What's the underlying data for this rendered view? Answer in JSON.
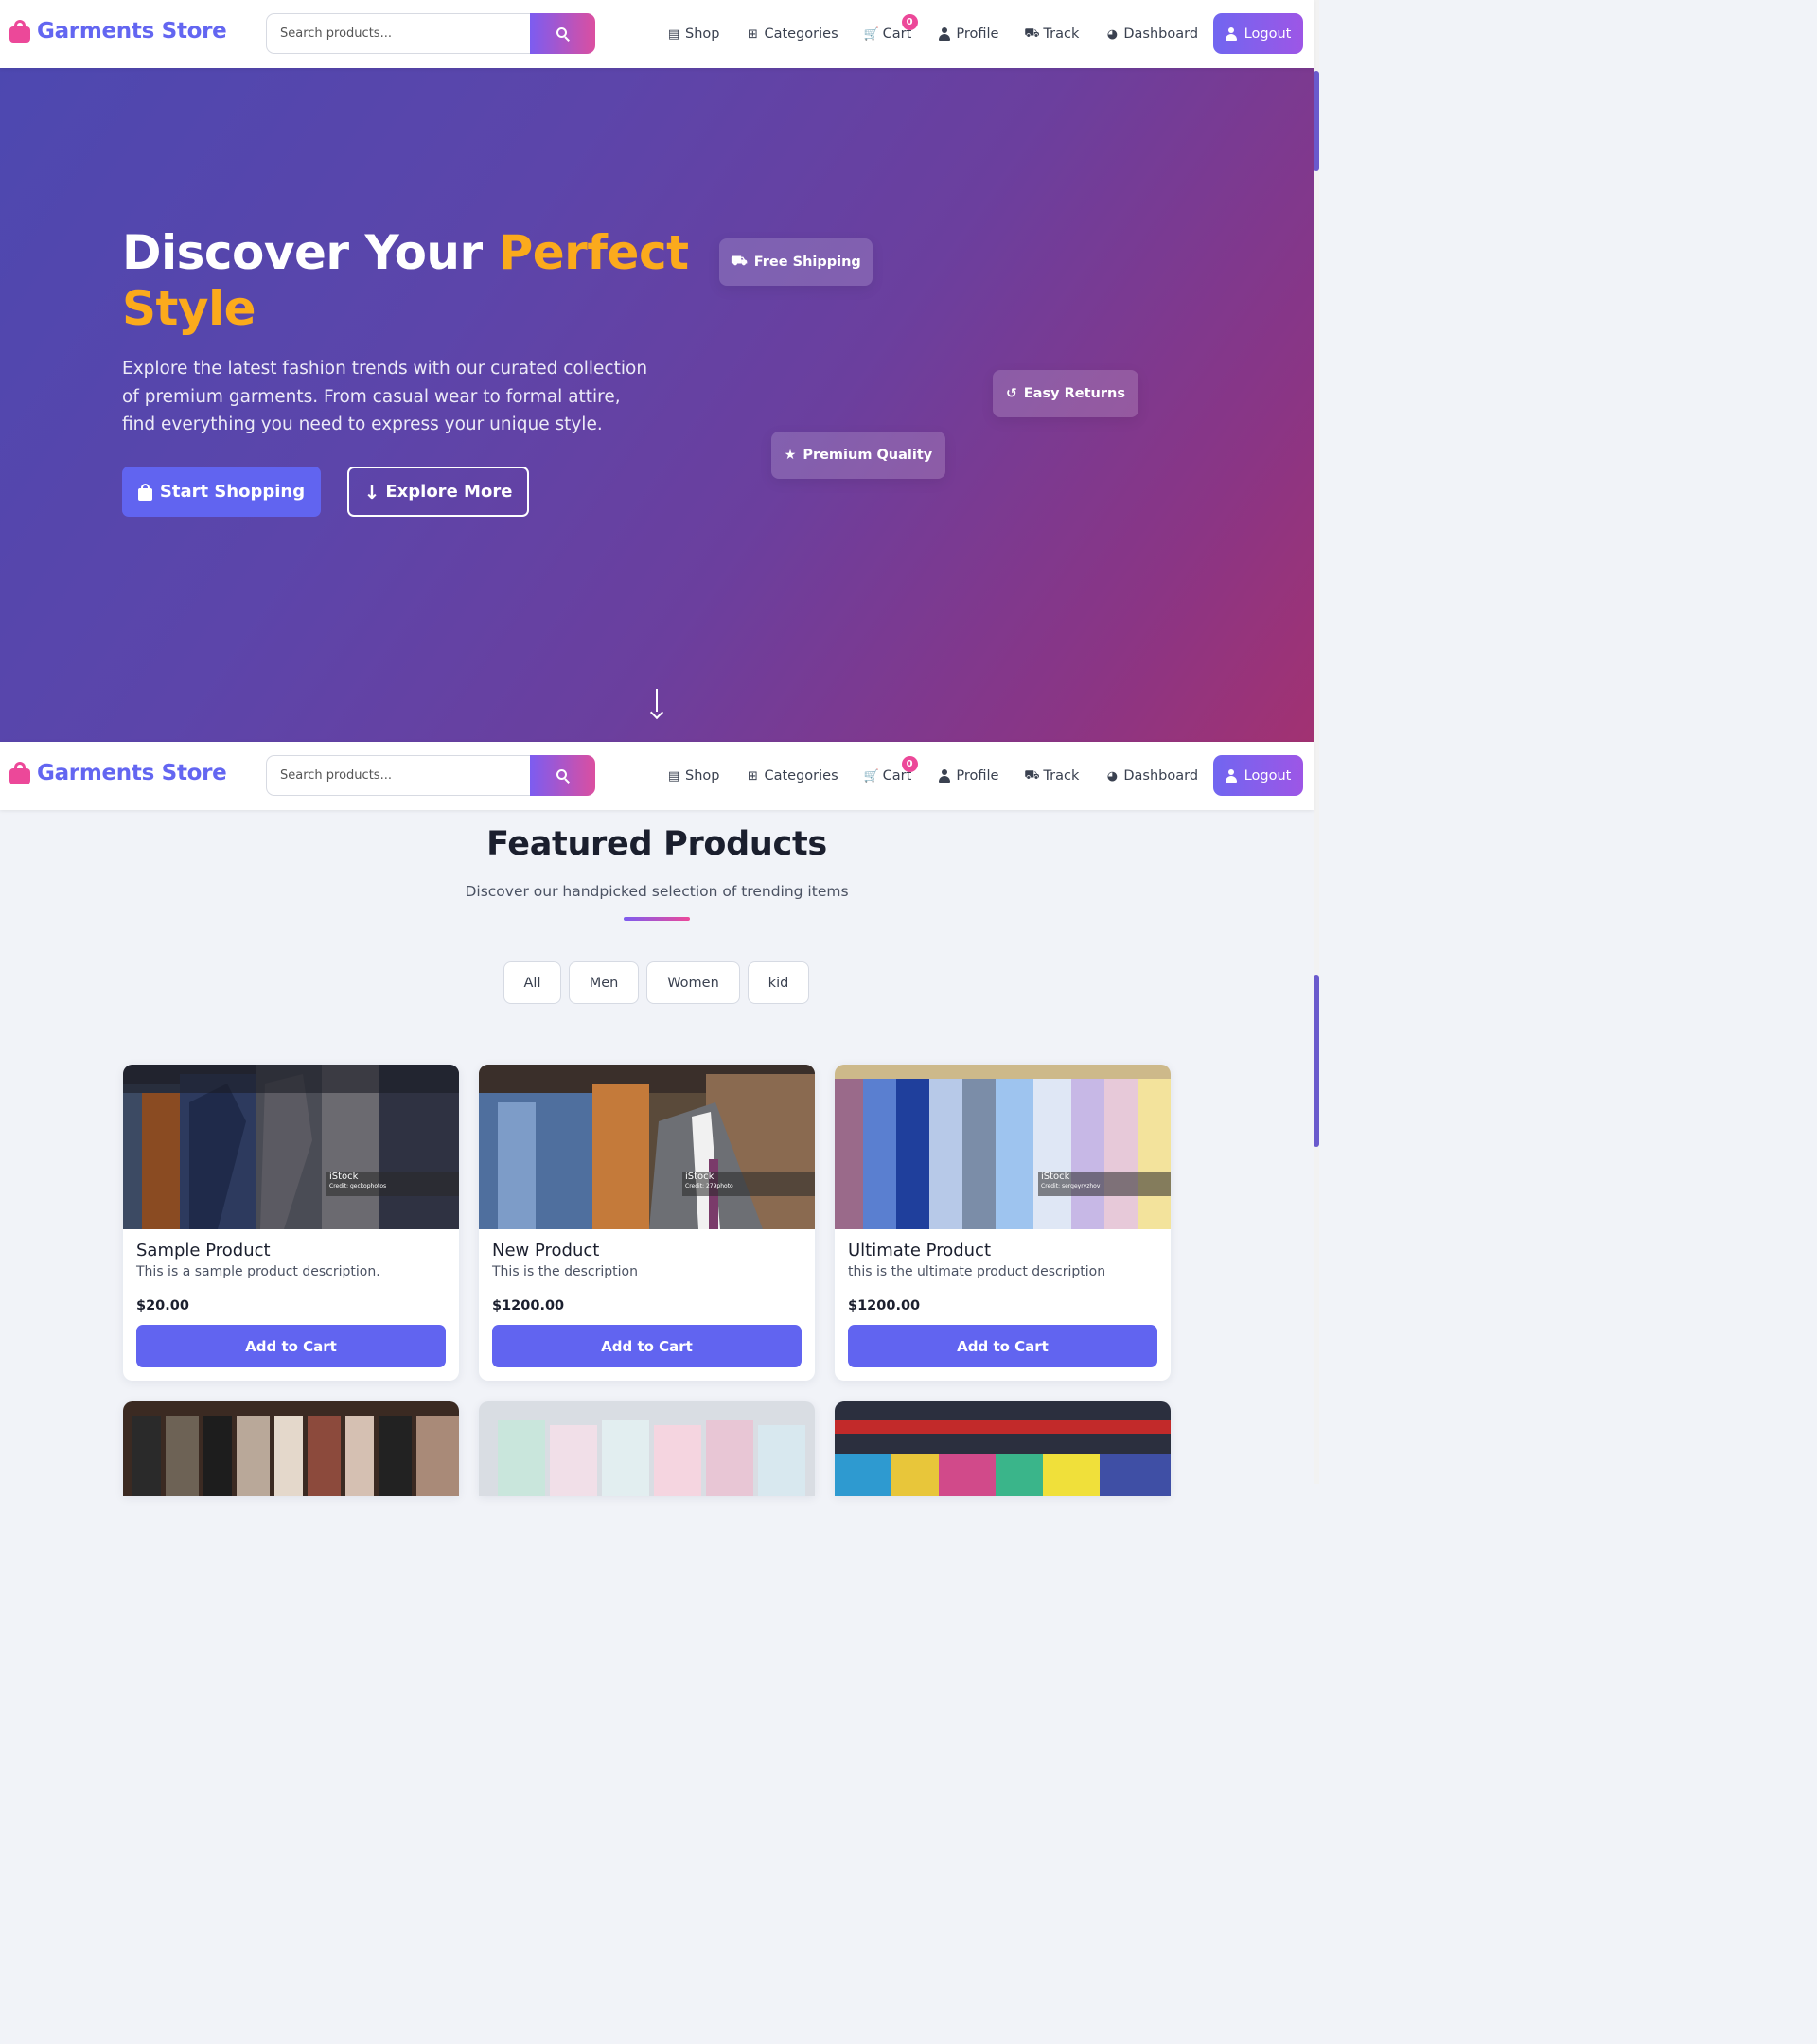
{
  "brand": {
    "name": "Garments Store"
  },
  "search": {
    "placeholder": "Search products..."
  },
  "nav": {
    "shop": "Shop",
    "categories": "Categories",
    "cart": "Cart",
    "cart_count": "0",
    "profile": "Profile",
    "track": "Track",
    "dashboard": "Dashboard",
    "logout": "Logout"
  },
  "hero": {
    "title_part1": "Discover Your ",
    "title_accent": "Perfect Style",
    "subtitle": "Explore the latest fashion trends with our curated collection of premium garments. From casual wear to formal attire, find everything you need to express your unique style.",
    "primary_button": "Start Shopping",
    "secondary_button": "Explore More",
    "chips": {
      "shipping": "Free Shipping",
      "returns": "Easy Returns",
      "quality": "Premium Quality"
    }
  },
  "featured": {
    "title": "Featured Products",
    "subtitle": "Discover our handpicked selection of trending items",
    "filters": [
      "All",
      "Men",
      "Women",
      "kid"
    ]
  },
  "products": [
    {
      "name": "Sample Product",
      "description": "This is a sample product description.",
      "price": "$20.00",
      "button": "Add to Cart",
      "watermark": "iStock",
      "credit": "Credit: geckophotos"
    },
    {
      "name": "New Product",
      "description": "This is the description",
      "price": "$1200.00",
      "button": "Add to Cart",
      "watermark": "iStock",
      "credit": "Credit: 279photo"
    },
    {
      "name": "Ultimate Product",
      "description": "this is the ultimate product description",
      "price": "$1200.00",
      "button": "Add to Cart",
      "watermark": "iStock",
      "credit": "Credit: sergeyryzhov"
    }
  ],
  "colors": {
    "brand": "#6366f1",
    "accent_pink": "#ec4899",
    "accent_orange": "#fbaa1c",
    "button": "#6164f0"
  }
}
